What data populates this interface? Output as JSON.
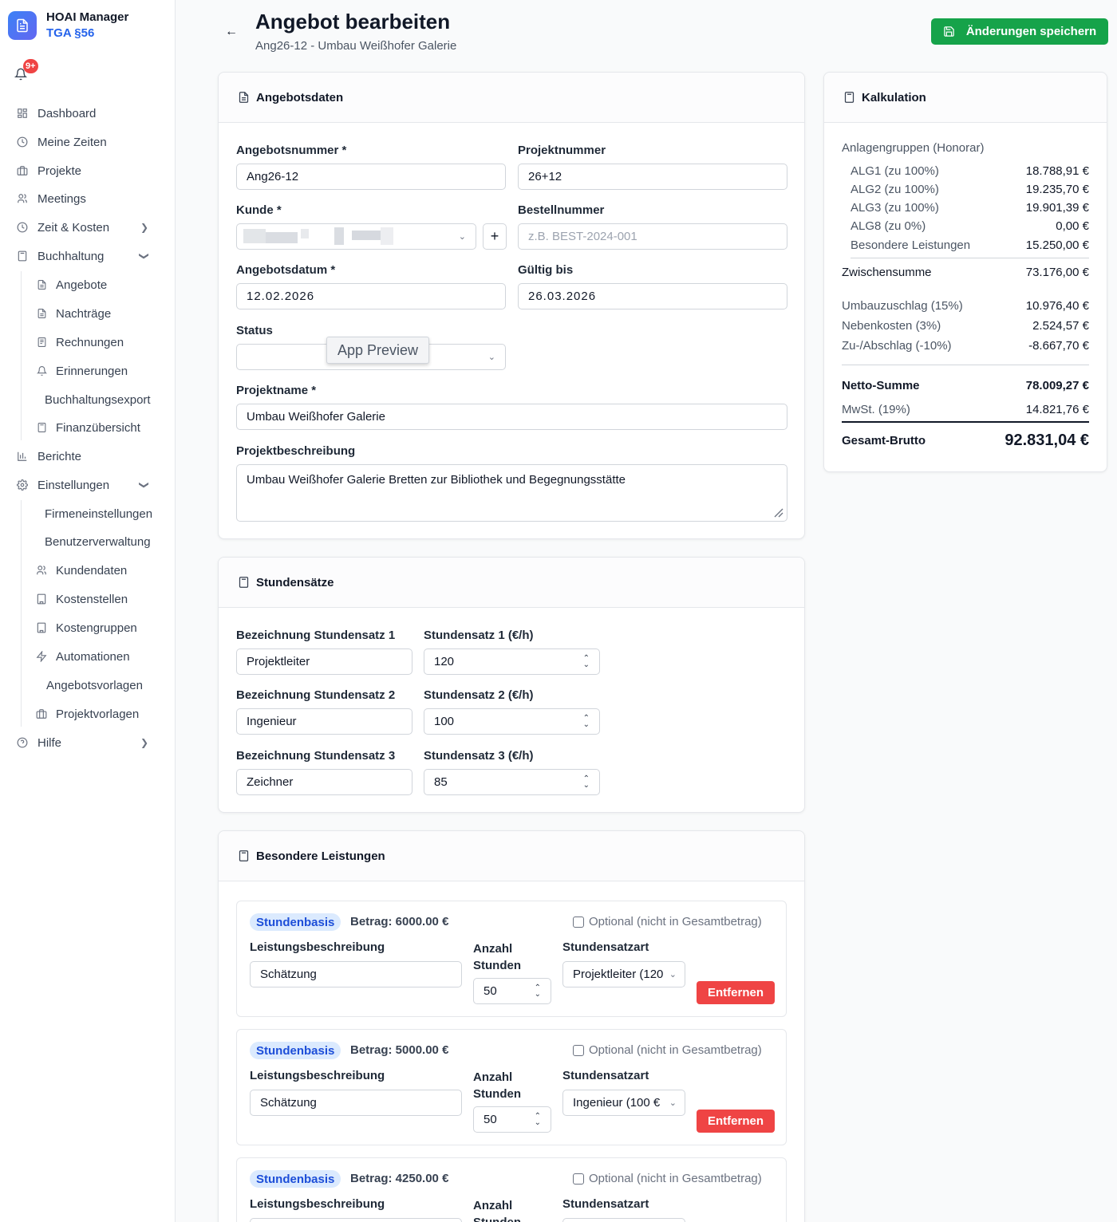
{
  "brand": {
    "name": "HOAI Manager",
    "sub": "TGA §56"
  },
  "notifications": {
    "badge": "9+"
  },
  "nav": {
    "dashboard": "Dashboard",
    "meine_zeiten": "Meine Zeiten",
    "projekte": "Projekte",
    "meetings": "Meetings",
    "zeit_kosten": "Zeit & Kosten",
    "buchhaltung": "Buchhaltung",
    "angebote": "Angebote",
    "nachtraege": "Nachträge",
    "rechnungen": "Rechnungen",
    "erinnerungen": "Erinnerungen",
    "buchhaltungsexport": "Buchhaltungsexport",
    "finanzuebersicht": "Finanzübersicht",
    "berichte": "Berichte",
    "einstellungen": "Einstellungen",
    "firmeneinstellungen": "Firmeneinstellungen",
    "benutzerverwaltung": "Benutzerverwaltung",
    "kundendaten": "Kundendaten",
    "kostenstellen": "Kostenstellen",
    "kostengruppen": "Kostengruppen",
    "automationen": "Automationen",
    "angebotsvorlagen": "Angebotsvorlagen",
    "projektvorlagen": "Projektvorlagen",
    "hilfe": "Hilfe"
  },
  "header": {
    "title": "Angebot bearbeiten",
    "subtitle": "Ang26-12 - Umbau Weißhofer Galerie",
    "save_label": "Änderungen speichern"
  },
  "angebotsdaten": {
    "heading": "Angebotsdaten",
    "angebotsnummer_label": "Angebotsnummer *",
    "angebotsnummer": "Ang26-12",
    "projektnummer_label": "Projektnummer",
    "projektnummer": "26+12",
    "kunde_label": "Kunde *",
    "bestellnummer_label": "Bestellnummer",
    "bestellnummer_placeholder": "z.B. BEST-2024-001",
    "angebotsdatum_label": "Angebotsdatum *",
    "angebotsdatum": "12.02.2026",
    "gueltig_label": "Gültig bis",
    "gueltig": "26.03.2026",
    "status_label": "Status",
    "tooltip": "App Preview",
    "projektname_label": "Projektname *",
    "projektname": "Umbau Weißhofer Galerie",
    "beschreibung_label": "Projektbeschreibung",
    "beschreibung": "Umbau Weißhofer Galerie Bretten zur Bibliothek und Begegnungsstätte"
  },
  "stundensaetze": {
    "heading": "Stundensätze",
    "rows": [
      {
        "name_label": "Bezeichnung Stundensatz 1",
        "name": "Projektleiter",
        "rate_label": "Stundensatz 1 (€/h)",
        "rate": "120"
      },
      {
        "name_label": "Bezeichnung Stundensatz 2",
        "name": "Ingenieur",
        "rate_label": "Stundensatz 2 (€/h)",
        "rate": "100"
      },
      {
        "name_label": "Bezeichnung Stundensatz 3",
        "name": "Zeichner",
        "rate_label": "Stundensatz 3 (€/h)",
        "rate": "85"
      }
    ]
  },
  "besondere": {
    "heading": "Besondere Leistungen",
    "badge": "Stundenbasis",
    "optional_label": "Optional (nicht in Gesamtbetrag)",
    "desc_label": "Leistungsbeschreibung",
    "anzahl_label_1": "Anzahl",
    "anzahl_label_2": "Stunden",
    "satzart_label": "Stundensatzart",
    "remove_label": "Entfernen",
    "items": [
      {
        "betrag": "Betrag: 6000.00 €",
        "desc": "Schätzung",
        "stunden": "50",
        "satzart": "Projektleiter (120"
      },
      {
        "betrag": "Betrag: 5000.00 €",
        "desc": "Schätzung",
        "stunden": "50",
        "satzart": "Ingenieur (100 €"
      },
      {
        "betrag": "Betrag: 4250.00 €",
        "desc": "",
        "stunden": "",
        "satzart": ""
      }
    ]
  },
  "kalkulation": {
    "heading": "Kalkulation",
    "group_title": "Anlagengruppen (Honorar)",
    "groups": [
      {
        "label": "ALG1 (zu 100%)",
        "value": "18.788,91 €"
      },
      {
        "label": "ALG2 (zu 100%)",
        "value": "19.235,70 €"
      },
      {
        "label": "ALG3 (zu 100%)",
        "value": "19.901,39 €"
      },
      {
        "label": "ALG8 (zu 0%)",
        "value": "0,00 €"
      },
      {
        "label": "Besondere Leistungen",
        "value": "15.250,00 €"
      }
    ],
    "zwischensumme_label": "Zwischensumme",
    "zwischensumme": "73.176,00 €",
    "umbau_label": "Umbauzuschlag (15%)",
    "umbau": "10.976,40 €",
    "neben_label": "Nebenkosten (3%)",
    "neben": "2.524,57 €",
    "zu_label": "Zu-/Abschlag (-10%)",
    "zu": "-8.667,70 €",
    "netto_label": "Netto-Summe",
    "netto": "78.009,27 €",
    "mwst_label": "MwSt. (19%)",
    "mwst": "14.821,76 €",
    "brutto_label": "Gesamt-Brutto",
    "brutto": "92.831,04 €"
  }
}
